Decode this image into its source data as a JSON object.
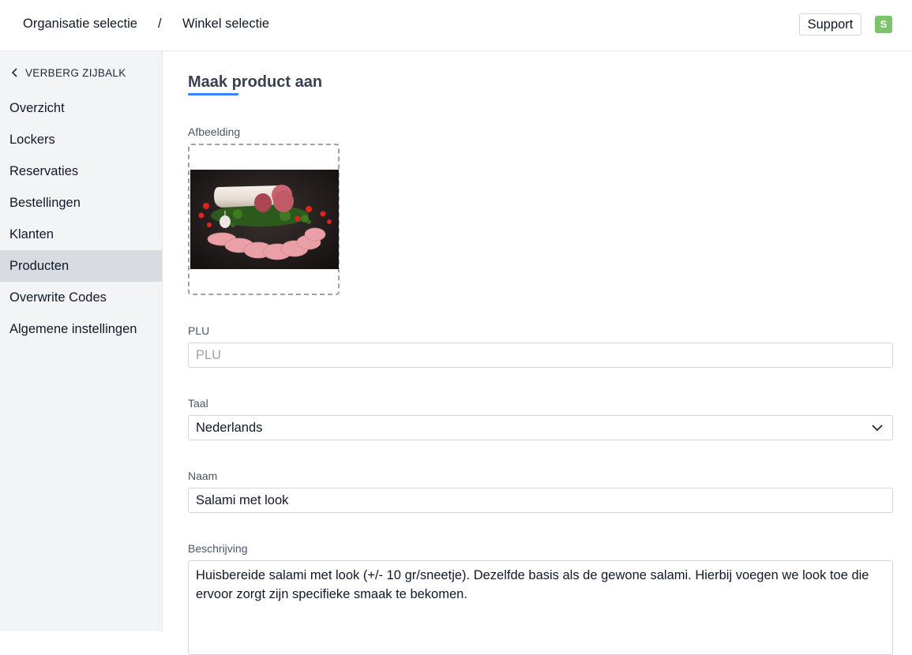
{
  "header": {
    "breadcrumb_org": "Organisatie selectie",
    "breadcrumb_separator": "/",
    "breadcrumb_shop": "Winkel selectie",
    "support_label": "Support",
    "avatar_initial": "S",
    "avatar_color": "#7cc36b"
  },
  "sidebar": {
    "hide_label": "VERBERG ZIJBALK",
    "items": [
      {
        "label": "Overzicht"
      },
      {
        "label": "Lockers"
      },
      {
        "label": "Reservaties"
      },
      {
        "label": "Bestellingen"
      },
      {
        "label": "Klanten"
      },
      {
        "label": "Producten",
        "active": true
      },
      {
        "label": "Overwrite Codes"
      },
      {
        "label": "Algemene instellingen"
      }
    ]
  },
  "main": {
    "title": "Maak product aan",
    "accent_color": "#3b82f6",
    "image": {
      "label": "Afbeelding"
    },
    "plu": {
      "label": "PLU",
      "placeholder": "PLU",
      "value": ""
    },
    "language": {
      "label": "Taal",
      "selected": "Nederlands"
    },
    "name": {
      "label": "Naam",
      "value": "Salami met look"
    },
    "description": {
      "label": "Beschrijving",
      "value": "Huisbereide salami met look (+/- 10 gr/sneetje). Dezelfde basis als de gewone salami. Hierbij voegen we look toe die ervoor zorgt zijn specifieke smaak te bekomen."
    }
  }
}
